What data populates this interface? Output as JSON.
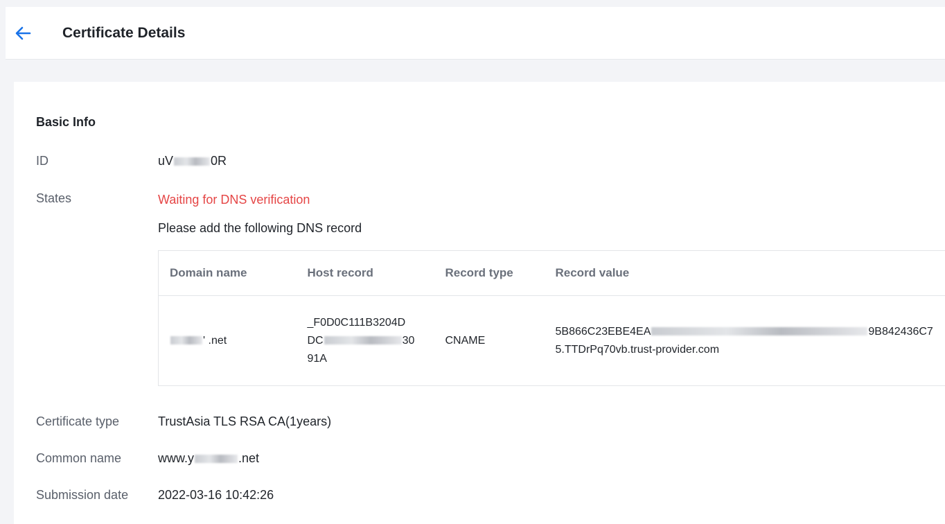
{
  "header": {
    "title": "Certificate Details",
    "back_icon": "arrow-left-icon",
    "accent_color": "#1a73e8"
  },
  "basic_info": {
    "section_title": "Basic Info",
    "id": {
      "label": "ID",
      "value_start": "uV",
      "value_end": "0R"
    },
    "states": {
      "label": "States",
      "status": "Waiting for DNS verification",
      "status_color": "#e54545",
      "instruction": "Please add the following DNS record"
    },
    "dns_table": {
      "columns": [
        "Domain name",
        "Host record",
        "Record type",
        "Record value"
      ],
      "row": {
        "domain_suffix": "' .net",
        "host_record_line1": "_F0D0C111B3204D",
        "host_record_line2_start": "DC",
        "host_record_line2_end": "30",
        "host_record_line3": "91A",
        "record_type": "CNAME",
        "record_value_line1_start": "5B866C23EBE4EA",
        "record_value_line1_end": "9B842436C7",
        "record_value_line2": "5.TTDrPq70vb.trust-provider.com"
      }
    },
    "certificate_type": {
      "label": "Certificate type",
      "value": "TrustAsia TLS RSA CA(1years)"
    },
    "common_name": {
      "label": "Common name",
      "value_start": "www.y",
      "value_end": ".net"
    },
    "submission_date": {
      "label": "Submission date",
      "value": "2022-03-16 10:42:26"
    }
  }
}
